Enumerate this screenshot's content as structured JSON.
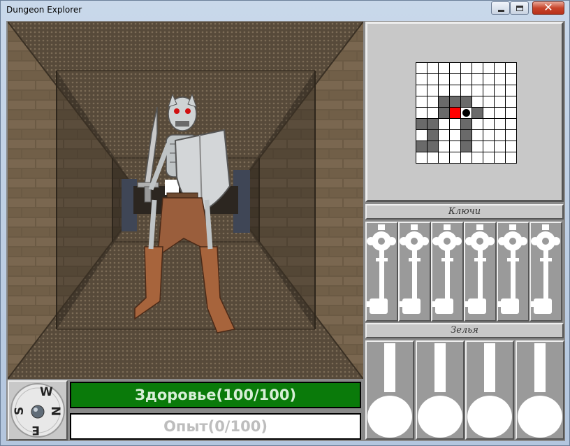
{
  "window": {
    "title": "Dungeon Explorer",
    "close_glyph": "✕"
  },
  "view": {
    "enemy": "skeleton-warrior-with-sword-and-shield"
  },
  "minimap": {
    "size": 9,
    "cells": [
      "000000000",
      "000000000",
      "000000000",
      "001110000",
      "001EP1000",
      "110010000",
      "010010000",
      "110010000",
      "000000000"
    ],
    "legend": {
      "wall": "#6a6a6a",
      "floor": "#ffffff",
      "enemy": "#ff0000",
      "player": "#000000"
    }
  },
  "inventory": {
    "keys_label": "Ключи",
    "keys_count": 6,
    "potions_label": "Зелья",
    "potions_count": 4
  },
  "compass": {
    "north": "N",
    "south": "S",
    "east": "E",
    "west": "W"
  },
  "status": {
    "health_text": "Здоровье(100/100)",
    "health_current": 100,
    "health_max": 100,
    "exp_text": "Опыт(0/100)",
    "exp_current": 0,
    "exp_max": 100,
    "bar_color": "#0a7a0a"
  }
}
